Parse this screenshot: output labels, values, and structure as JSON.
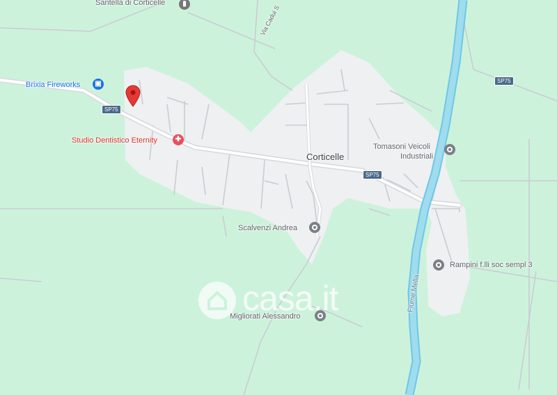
{
  "map": {
    "colors": {
      "land": "#cdf2dc",
      "urban": "#eef0f1",
      "road": "#ffffff",
      "road_outline": "#d5d9dc",
      "river": "#9fdcee",
      "river_edge": "#6ec7e6",
      "road_shield": "#4a6a8a",
      "pin": "#e53935"
    },
    "places": {
      "town": "Corticelle",
      "santella": "Santella di Corticelle",
      "brixia": "Brixia Fireworks",
      "studio": "Studio Dentistico Eternity",
      "tomasoni_1": "Tomasoni Veicoli",
      "tomasoni_2": "Industriali",
      "scalvenzi": "Scalvenzi Andrea",
      "rampini": "Rampini f.lli soc sempl 3",
      "migliorati": "Migliorati Alessandro"
    },
    "roads": {
      "sp75_a": "SP75",
      "sp75_b": "SP75",
      "sp75_c": "SP75",
      "via_cadui": "Via Cadui S",
      "river": "Fiume Mella"
    },
    "icons": {
      "santella": "church-icon",
      "brixia": "lock-icon",
      "studio": "tooth-icon",
      "tomasoni": "place-icon",
      "scalvenzi": "place-icon",
      "rampini": "place-icon",
      "migliorati": "place-icon",
      "marker": "location-pin-icon"
    },
    "watermark": "casa.it"
  }
}
